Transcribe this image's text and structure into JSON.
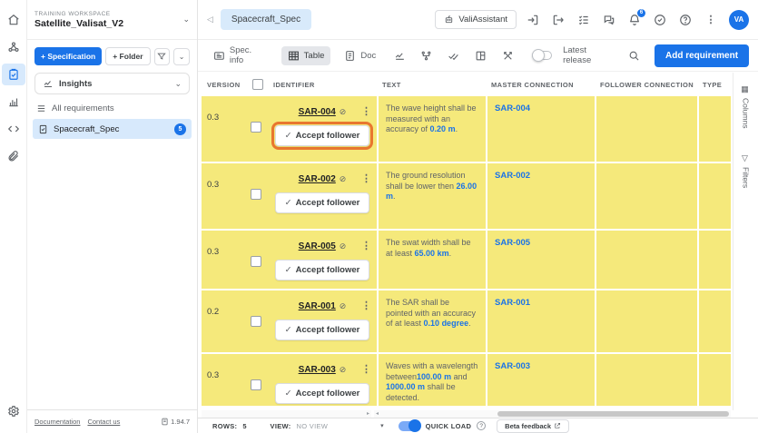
{
  "rail": {
    "items": [
      {
        "name": "home-icon",
        "active": false
      },
      {
        "name": "modules-icon",
        "active": false
      },
      {
        "name": "requirements-icon",
        "active": true
      },
      {
        "name": "analyses-icon",
        "active": false
      },
      {
        "name": "scripting-icon",
        "active": false
      },
      {
        "name": "attachments-icon",
        "active": false
      }
    ]
  },
  "sidebar": {
    "workspace_label": "TRAINING WORKSPACE",
    "workspace_name": "Satellite_Valisat_V2",
    "specification_button": "+ Specification",
    "folder_button": "+ Folder",
    "insights_label": "Insights",
    "all_requirements_label": "All requirements",
    "tree": [
      {
        "label": "Spacecraft_Spec",
        "badge": "5"
      }
    ],
    "footer": {
      "documentation_link": "Documentation",
      "contact_link": "Contact us",
      "version": "1.94.7"
    }
  },
  "header": {
    "tab": "Spacecraft_Spec",
    "assistant_button": "ValiAssistant",
    "notification_count": "6",
    "avatar_initials": "VA"
  },
  "toolbar": {
    "spec_info": "Spec. info",
    "table": "Table",
    "doc": "Doc",
    "latest_release_label": "Latest release",
    "add_requirement_button": "Add requirement"
  },
  "table": {
    "columns": {
      "version": "VERSION",
      "identifier": "IDENTIFIER",
      "text": "TEXT",
      "master_connection": "MASTER CONNECTION",
      "follower_connection": "FOLLOWER CONNECTION",
      "type": "TYPE"
    },
    "rows": [
      {
        "version": "0.3",
        "identifier": "SAR-004",
        "action": "Accept follower",
        "highlighted": true,
        "text_parts": [
          {
            "s": "The wave height shall be measured with an accuracy of "
          },
          {
            "s": "0.20",
            "v": true
          },
          {
            "s": " m",
            "v": true
          },
          {
            "s": "."
          }
        ],
        "master": "SAR-004"
      },
      {
        "version": "0.3",
        "identifier": "SAR-002",
        "action": "Accept follower",
        "highlighted": false,
        "text_parts": [
          {
            "s": "The ground resolution shall be lower then "
          },
          {
            "s": "26.00",
            "v": true
          },
          {
            "s": " m",
            "v": true
          },
          {
            "s": "."
          }
        ],
        "master": "SAR-002"
      },
      {
        "version": "0.3",
        "identifier": "SAR-005",
        "action": "Accept follower",
        "highlighted": false,
        "text_parts": [
          {
            "s": "The swat width shall be at least "
          },
          {
            "s": "65.00",
            "v": true
          },
          {
            "s": " km",
            "v": true
          },
          {
            "s": "."
          }
        ],
        "master": "SAR-005"
      },
      {
        "version": "0.2",
        "identifier": "SAR-001",
        "action": "Accept follower",
        "highlighted": false,
        "text_parts": [
          {
            "s": "The SAR shall be pointed with an accuracy of at least "
          },
          {
            "s": "0.10",
            "v": true
          },
          {
            "s": " degree",
            "v": true
          },
          {
            "s": "."
          }
        ],
        "master": "SAR-001"
      },
      {
        "version": "0.3",
        "identifier": "SAR-003",
        "action": "Accept follower",
        "highlighted": false,
        "text_parts": [
          {
            "s": "Waves with a wavelength between"
          },
          {
            "s": "100.00",
            "v": true
          },
          {
            "s": " m",
            "v": true
          },
          {
            "s": " and "
          },
          {
            "s": "1000.00",
            "v": true
          },
          {
            "s": " m",
            "v": true
          },
          {
            "s": " shall be detected."
          }
        ],
        "master": "SAR-003"
      }
    ]
  },
  "side_panel": {
    "columns_label": "Columns",
    "filters_label": "Filters"
  },
  "bottom_bar": {
    "rows_label": "ROWS:",
    "rows_value": "5",
    "view_label": "VIEW:",
    "view_value": "NO VIEW",
    "quick_load_label": "QUICK LOAD",
    "beta_feedback_button": "Beta feedback"
  },
  "colors": {
    "accent_blue": "#1a73e8",
    "row_yellow": "#f5e97b",
    "selection_blue": "#d7e9fc",
    "annotation_orange": "#e8772f"
  }
}
